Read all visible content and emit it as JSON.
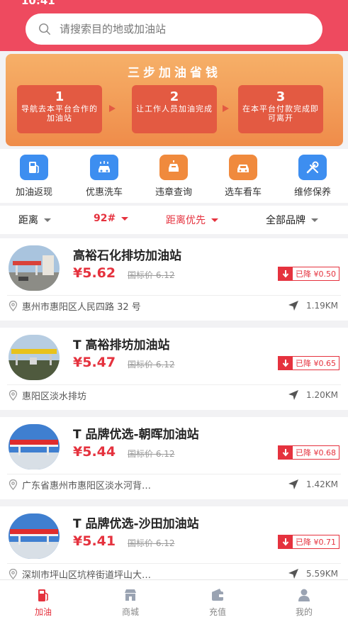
{
  "status_bar": {
    "time": "10:41",
    "right": ""
  },
  "search": {
    "placeholder": "请搜索目的地或加油站"
  },
  "banner": {
    "title": "三步加油省钱",
    "steps": [
      {
        "num": "1",
        "text": "导航去本平台合作的加油站"
      },
      {
        "num": "2",
        "text": "让工作人员加油完成"
      },
      {
        "num": "3",
        "text": "在本平台付款完成即可离开"
      }
    ]
  },
  "quick_menu": [
    {
      "label": "加油返现",
      "icon": "fuel-pump-icon",
      "color": "#3d8ef0"
    },
    {
      "label": "优惠洗车",
      "icon": "car-wash-icon",
      "color": "#3d8ef0"
    },
    {
      "label": "违章查询",
      "icon": "traffic-camera-icon",
      "color": "#f08a3d"
    },
    {
      "label": "选车看车",
      "icon": "car-icon",
      "color": "#f08a3d"
    },
    {
      "label": "维修保养",
      "icon": "wrench-icon",
      "color": "#3d8ef0"
    }
  ],
  "filters": [
    {
      "label": "距离",
      "active": false
    },
    {
      "label": "92#",
      "active": true
    },
    {
      "label": "距离优先",
      "active": true
    },
    {
      "label": "全部品牌",
      "active": false
    }
  ],
  "stations": [
    {
      "name": "高裕石化排坊加油站",
      "price": "¥5.62",
      "old_price": "国标价 6.12",
      "drop": "已降 ¥0.50",
      "address": "惠州市惠阳区人民四路 32 号",
      "distance": "1.19KM"
    },
    {
      "name": "T 高裕排坊加油站",
      "price": "¥5.47",
      "old_price": "国标价 6.12",
      "drop": "已降 ¥0.65",
      "address": "惠阳区淡水排坊",
      "distance": "1.20KM"
    },
    {
      "name": "T 品牌优选-朝晖加油站",
      "price": "¥5.44",
      "old_price": "国标价 6.12",
      "drop": "已降 ¥0.68",
      "address": "广东省惠州市惠阳区淡水河背…",
      "distance": "1.42KM"
    },
    {
      "name": "T 品牌优选-沙田加油站",
      "price": "¥5.41",
      "old_price": "国标价 6.12",
      "drop": "已降 ¥0.71",
      "address": "深圳市坪山区坑梓街道坪山大…",
      "distance": "5.59KM"
    }
  ],
  "tabbar": [
    {
      "label": "加油",
      "icon": "fuel-pump-icon",
      "active": true
    },
    {
      "label": "商城",
      "icon": "store-icon",
      "active": false
    },
    {
      "label": "充值",
      "icon": "wallet-icon",
      "active": false
    },
    {
      "label": "我的",
      "icon": "user-icon",
      "active": false
    }
  ],
  "colors": {
    "brand_red": "#ee4a5f",
    "accent_red": "#e5323e",
    "banner_orange": "#ef8c4a"
  }
}
